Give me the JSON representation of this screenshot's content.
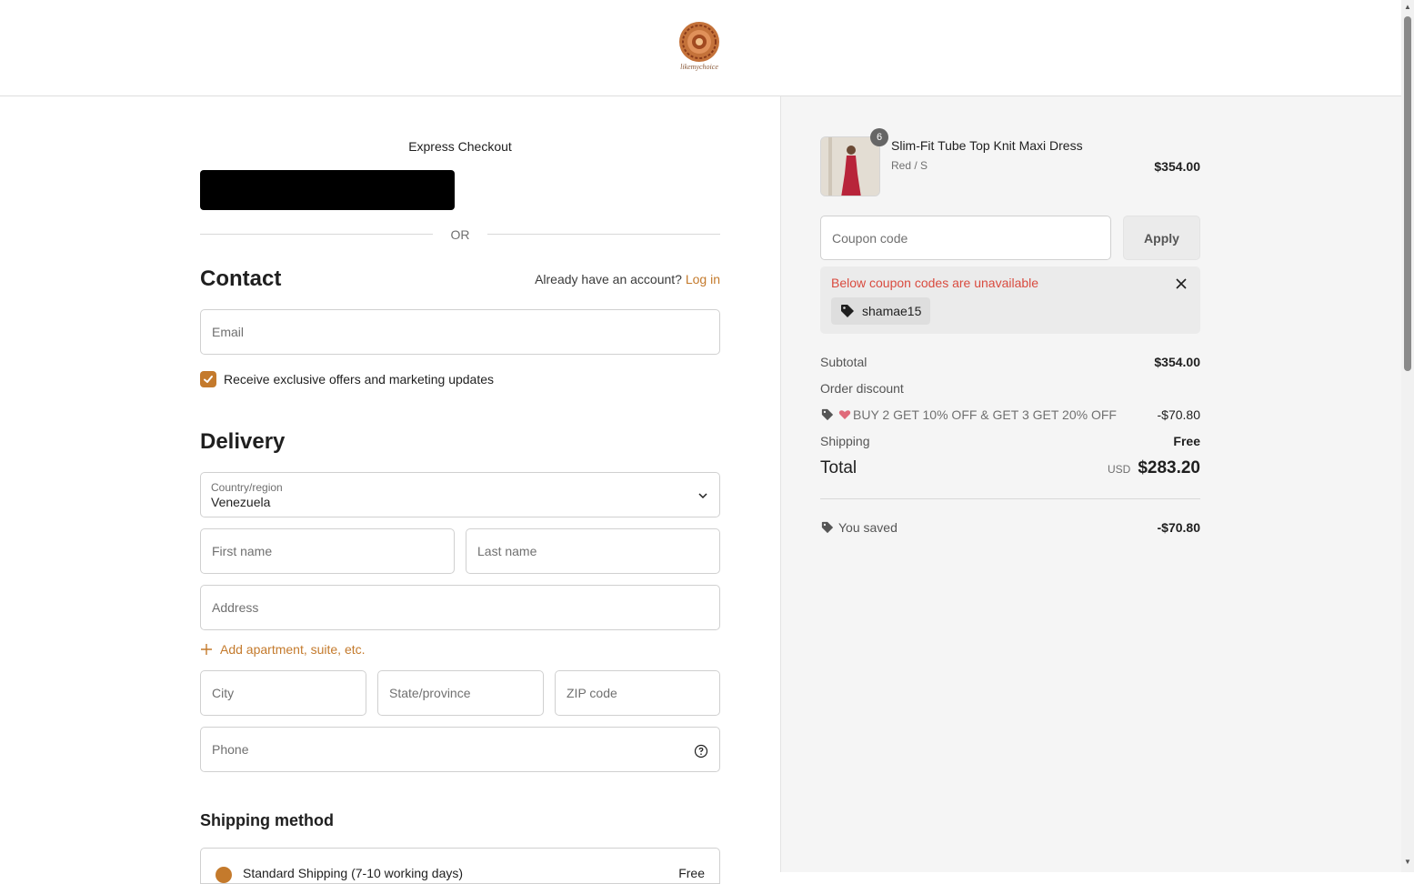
{
  "brand": {
    "logo_text": "likemychoice",
    "accent_color": "#c47a2c",
    "error_color": "#d94b3f"
  },
  "express": {
    "title": "Express Checkout",
    "or_text": "OR"
  },
  "contact": {
    "title": "Contact",
    "account_prompt": "Already have an account?",
    "login_link": "Log in",
    "email_placeholder": "Email",
    "marketing_label": "Receive exclusive offers and marketing updates",
    "marketing_checked": true
  },
  "delivery": {
    "title": "Delivery",
    "country_label": "Country/region",
    "country_value": "Venezuela",
    "first_name_placeholder": "First name",
    "last_name_placeholder": "Last name",
    "address_placeholder": "Address",
    "add_apartment": "Add apartment, suite, etc.",
    "city_placeholder": "City",
    "state_placeholder": "State/province",
    "zip_placeholder": "ZIP code",
    "phone_placeholder": "Phone"
  },
  "shipping_method": {
    "title": "Shipping method",
    "option_label": "Standard Shipping (7-10 working days)",
    "option_price": "Free"
  },
  "summary": {
    "product": {
      "name": "Slim-Fit Tube Top Knit Maxi Dress",
      "variant": "Red / S",
      "price": "$354.00",
      "quantity": "6"
    },
    "coupon_placeholder": "Coupon code",
    "apply_label": "Apply",
    "coupon_notice": "Below coupon codes are unavailable",
    "coupon_code": "shamae15",
    "subtotal_label": "Subtotal",
    "subtotal_value": "$354.00",
    "order_discount_label": "Order discount",
    "discount_name": "BUY 2 GET 10% OFF & GET 3 GET 20% OFF",
    "discount_value": "-$70.80",
    "shipping_label": "Shipping",
    "shipping_value": "Free",
    "total_label": "Total",
    "currency": "USD",
    "total_value": "$283.20",
    "saved_label": "You saved",
    "saved_value": "-$70.80"
  },
  "icons": [
    "logo-icon",
    "checkbox-check-icon",
    "chevron-down-icon",
    "plus-icon",
    "help-circle-icon",
    "tag-icon",
    "close-icon",
    "heart-emoji-icon"
  ]
}
